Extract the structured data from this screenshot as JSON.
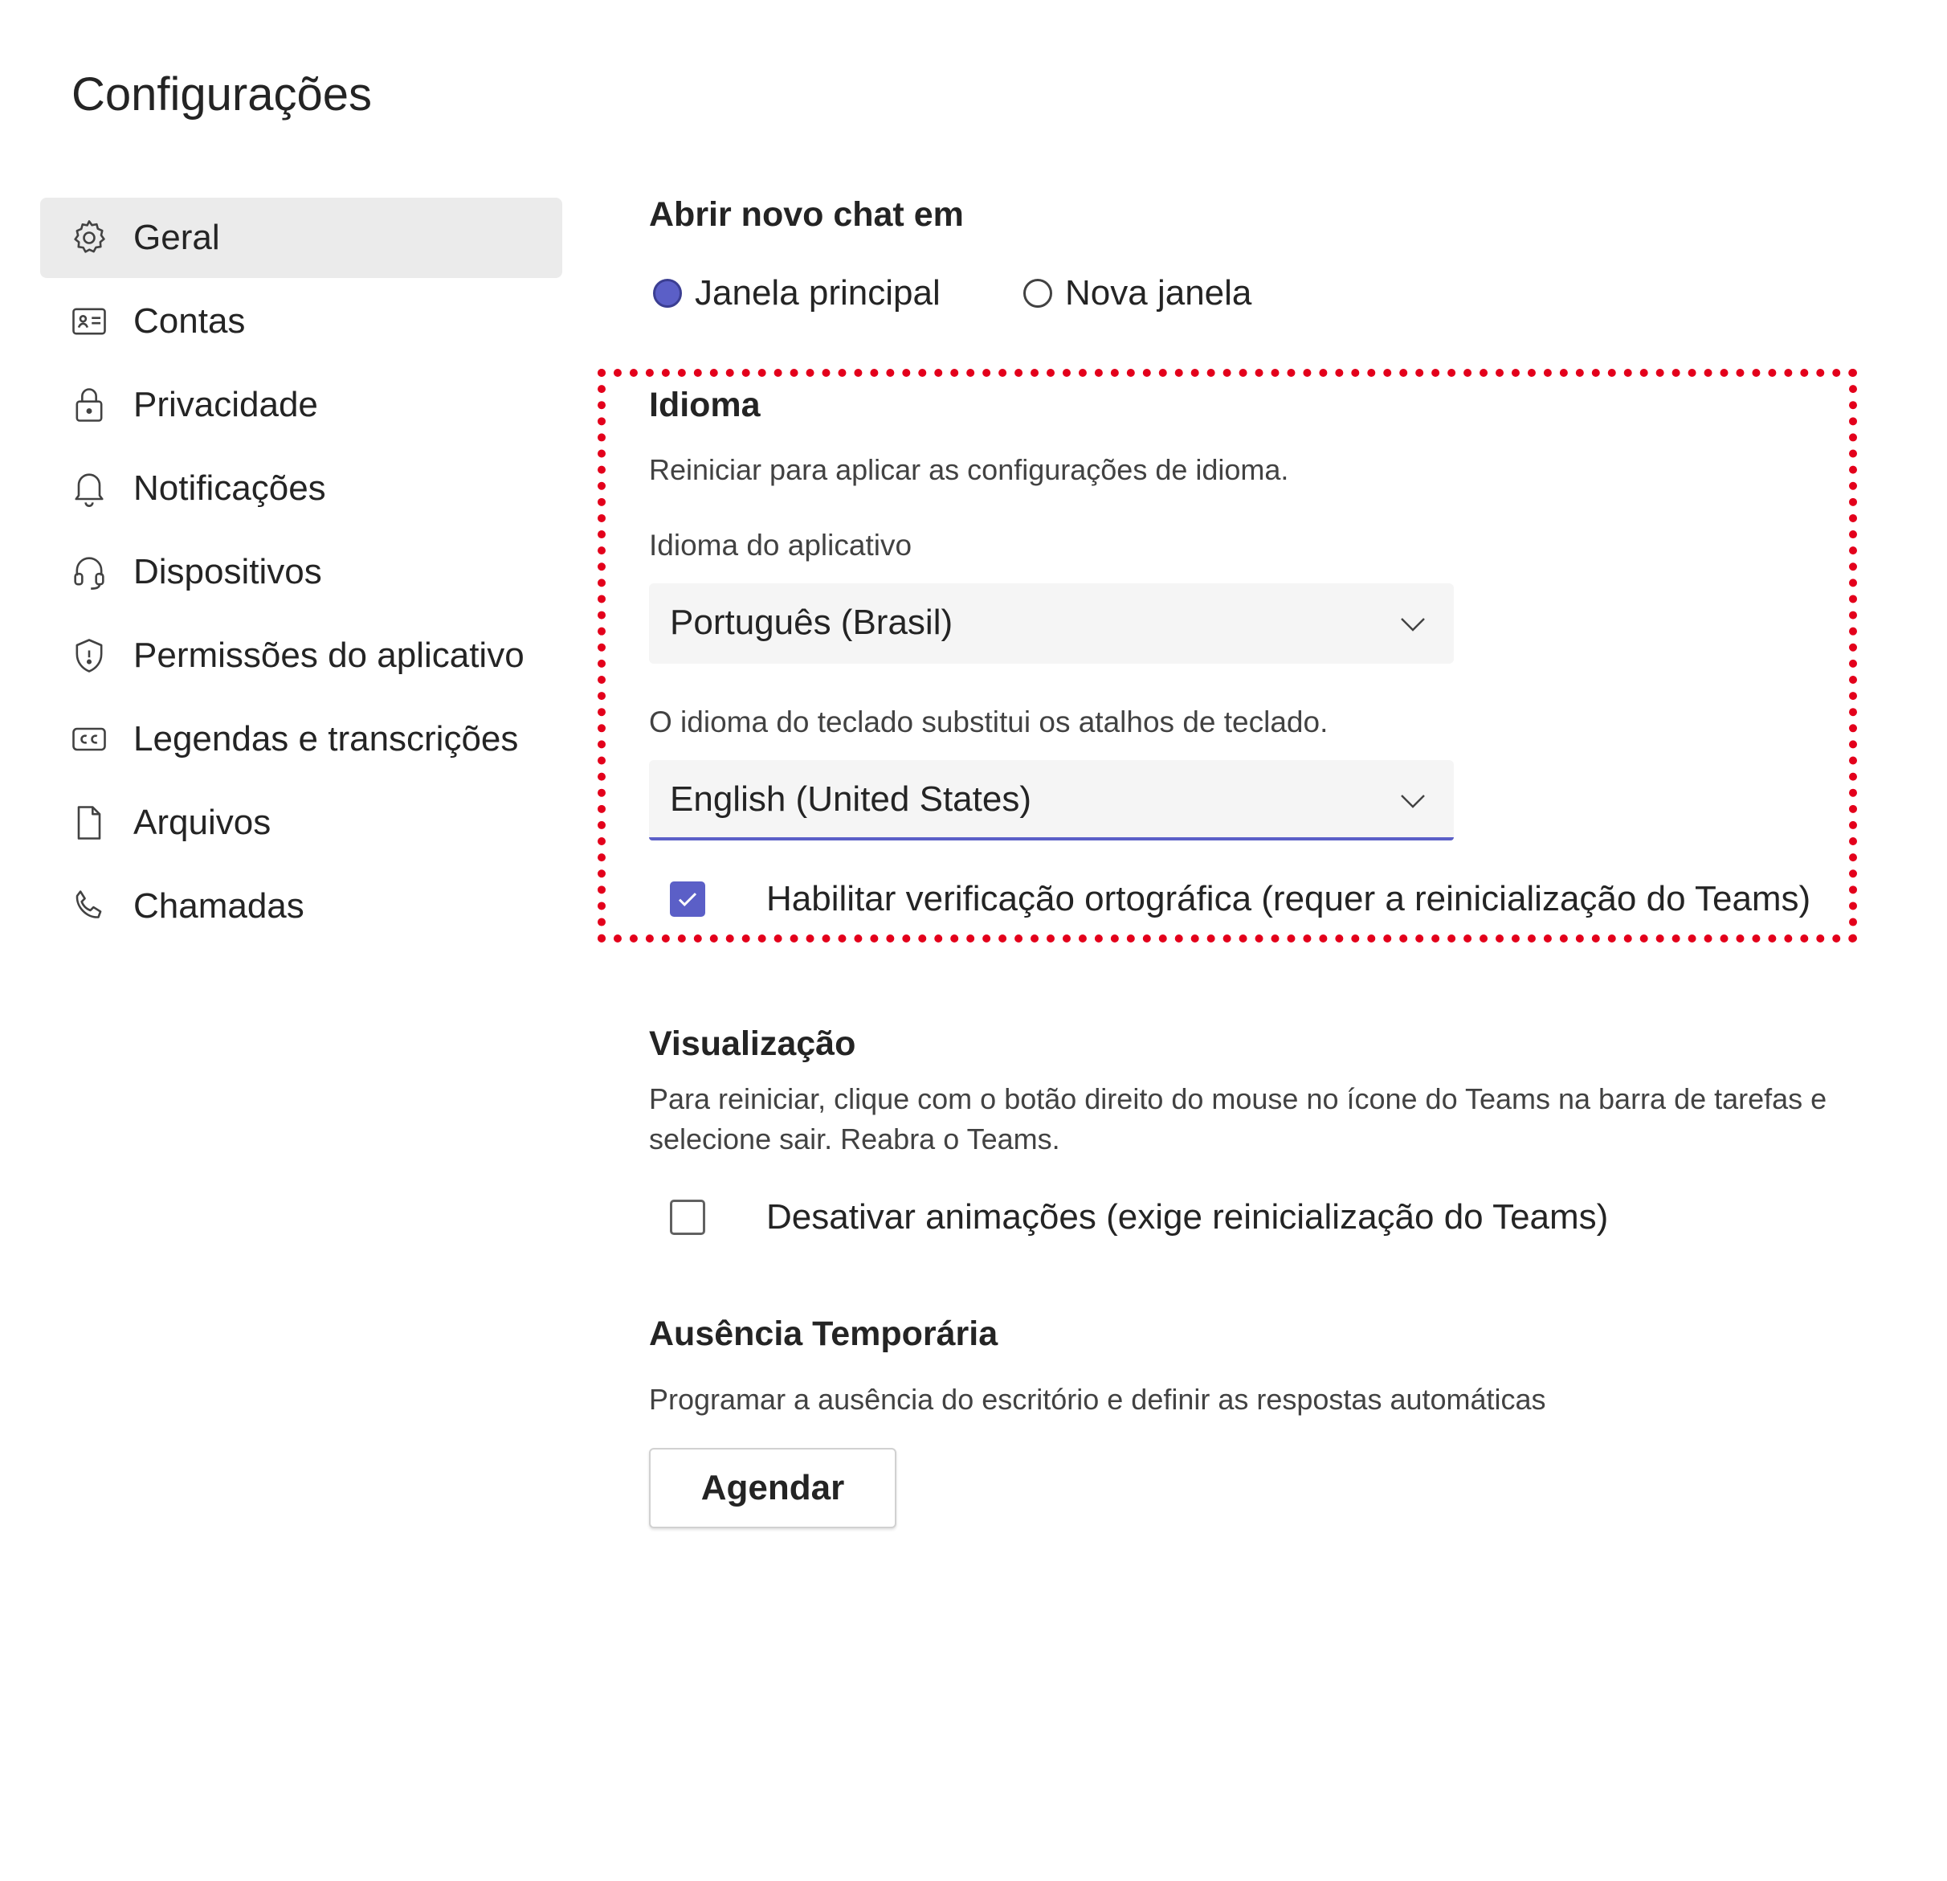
{
  "page": {
    "title": "Configurações"
  },
  "sidebar": {
    "items": [
      {
        "label": "Geral",
        "icon": "gear-icon",
        "active": true
      },
      {
        "label": "Contas",
        "icon": "id-card-icon"
      },
      {
        "label": "Privacidade",
        "icon": "lock-icon"
      },
      {
        "label": "Notificações",
        "icon": "bell-icon"
      },
      {
        "label": "Dispositivos",
        "icon": "headset-icon"
      },
      {
        "label": "Permissões do aplicativo",
        "icon": "shield-icon"
      },
      {
        "label": "Legendas e transcrições",
        "icon": "closed-captions-icon"
      },
      {
        "label": "Arquivos",
        "icon": "file-icon"
      },
      {
        "label": "Chamadas",
        "icon": "phone-icon"
      }
    ]
  },
  "open_chat": {
    "heading": "Abrir novo chat em",
    "options": [
      {
        "label": "Janela principal",
        "selected": true
      },
      {
        "label": "Nova janela",
        "selected": false
      }
    ]
  },
  "language": {
    "heading": "Idioma",
    "description": "Reiniciar para aplicar as configurações de idioma.",
    "app_language_label": "Idioma do aplicativo",
    "app_language_value": "Português (Brasil)",
    "keyboard_label": "O idioma do teclado substitui os atalhos de teclado.",
    "keyboard_value": "English (United States)",
    "spellcheck_label": "Habilitar verificação ortográfica (requer a reinicialização do Teams)",
    "spellcheck_checked": true
  },
  "display": {
    "heading": "Visualização",
    "description": "Para reiniciar, clique com o botão direito do mouse no ícone do Teams na barra de tarefas e selecione sair. Reabra o Teams.",
    "animations_label": "Desativar animações (exige reinicialização do Teams)",
    "animations_checked": false
  },
  "away": {
    "heading": "Ausência Temporária",
    "description": "Programar a ausência do escritório e definir as respostas automáticas",
    "button_label": "Agendar"
  },
  "colors": {
    "accent": "#5b5fc7",
    "highlight": "#e3001b",
    "active_nav_bg": "#ebebeb",
    "select_bg": "#f5f5f5"
  }
}
